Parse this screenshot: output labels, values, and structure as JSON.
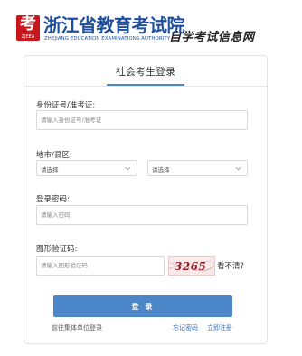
{
  "header": {
    "logo_mark": "考",
    "logo_caption": "ZJEEA",
    "org_name": "浙江省教育考试院",
    "org_name_en": "ZHEJIANG EDUCATION EXAMINATIONS AUTHORITY",
    "site_name": "自学考试信息网"
  },
  "login": {
    "tab_label": "社会考生登录",
    "id_label": "身份证号/准考证:",
    "id_placeholder": "请输入身份证号/准考证",
    "region_label": "地市/县区:",
    "city_value": "请选择",
    "district_value": "请选择",
    "password_label": "登录密码:",
    "password_placeholder": "请输入密码",
    "captcha_label": "图形验证码:",
    "captcha_placeholder": "请输入图形验证码",
    "captcha_code": "3265",
    "refresh_text": "看不清?",
    "login_button": "登 录",
    "group_login_link": "前往集体单位登录",
    "forgot_link": "忘记密码",
    "register_link": "立即注册"
  },
  "colors": {
    "brand_blue": "#1f4f9c",
    "accent": "#4a86c8",
    "logo_red": "#c8161d"
  }
}
